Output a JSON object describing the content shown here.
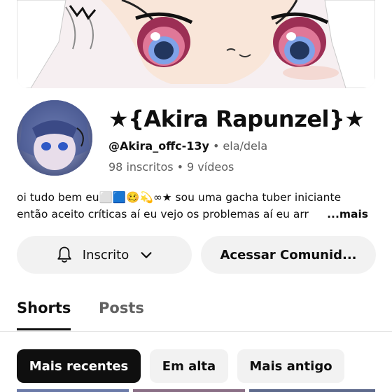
{
  "channel": {
    "name": "★{Akira Rapunzel}★",
    "handle": "@Akira_offc-13y",
    "separator": "•",
    "pronouns": "ela/dela",
    "subscribers": "98 inscritos",
    "videos": "9 vídeos"
  },
  "description": {
    "line1": "oi tudo bem eu⬜🟦🥴💫∞★  sou uma gacha tuber iniciante",
    "line2": "então aceito críticas aí eu vejo os problemas aí eu arr",
    "more": "...mais"
  },
  "actions": {
    "subscribe_label": "Inscrito",
    "community_label": "Acessar Comunid..."
  },
  "tabs": [
    {
      "label": "Shorts",
      "selected": true
    },
    {
      "label": "Posts",
      "selected": false
    }
  ],
  "filters": [
    {
      "label": "Mais recentes",
      "selected": true
    },
    {
      "label": "Em alta",
      "selected": false
    },
    {
      "label": "Mais antigo",
      "selected": false
    }
  ],
  "colors": {
    "text_primary": "#0f0f0f",
    "text_secondary": "#606060",
    "chip_bg": "#f2f2f2",
    "chip_active_bg": "#0f0f0f"
  },
  "icons": {
    "bell": "bell-icon",
    "chevron": "chevron-down-icon"
  }
}
